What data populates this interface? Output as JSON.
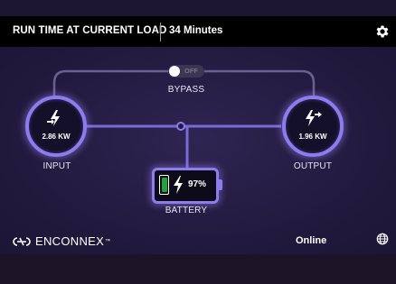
{
  "header": {
    "title": "RUN TIME AT CURRENT LOAD",
    "run_time": "34 Minutes",
    "settings_icon": "gear-icon"
  },
  "bypass": {
    "toggle_state": "OFF",
    "label": "BYPASS"
  },
  "input": {
    "label": "INPUT",
    "value": "2.86 KW",
    "icon": "bolt-in-icon"
  },
  "output": {
    "label": "OUTPUT",
    "value": "1.96 KW",
    "icon": "bolt-out-icon"
  },
  "battery": {
    "label": "BATTERY",
    "percent": "97%",
    "level": 0.97,
    "fill_color": "#1fa33a"
  },
  "footer": {
    "brand": "ENCONNEX",
    "trademark": "™",
    "status": "Online",
    "globe_icon": "globe-icon"
  },
  "colors": {
    "accent": "#8d7cf0",
    "header_bg": "#000000",
    "panel_bg": "#231b40"
  }
}
